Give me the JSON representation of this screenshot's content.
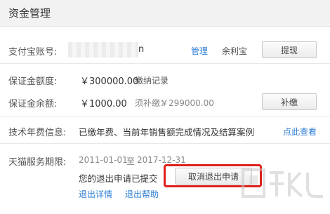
{
  "header": {
    "title": "资金管理"
  },
  "alipay_row": {
    "label": "支付宝账号:",
    "account_suffix": "n",
    "manage_link": "管理",
    "yuebao_link": "余利宝",
    "withdraw_button": "提现"
  },
  "deposit_limit_row": {
    "label": "保证金额度:",
    "amount": "￥300000.00",
    "record_link": "缴纳记录"
  },
  "deposit_balance_row": {
    "label": "保证金余额:",
    "amount": "￥1000.00",
    "topup_label": "须补缴：",
    "topup_amount": "￥299000.00",
    "topup_button": "补缴"
  },
  "annual_fee_row": {
    "label": "技术年费信息:",
    "status": "已缴年费、当前年销售额完成情况及结算案例",
    "view_link": "点此查看"
  },
  "service_period_row": {
    "label": "天猫服务期限:",
    "start_date": "2011-01-01",
    "separator": "至",
    "end_date": "2017-12-31",
    "exit_status": "您的退出申请已提交",
    "cancel_exit_button": "取消退出申请",
    "exit_details_link": "退出详情",
    "exit_help_link": "退出帮助"
  },
  "colors": {
    "link": "#2e7fd6",
    "highlight": "#e0201a",
    "header_bg": "#f2f2f2"
  }
}
